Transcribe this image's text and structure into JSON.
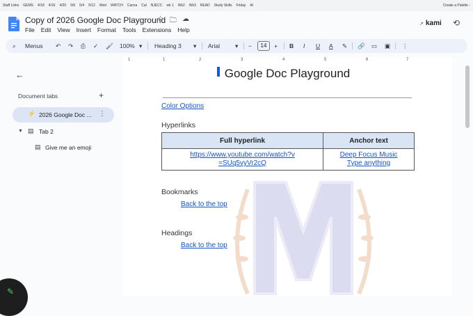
{
  "bookmarks": [
    "Staff Links",
    "GEMS",
    "4/18",
    "4/16",
    "4/20",
    "5/6",
    "5/4",
    "5/12",
    "Wed",
    "WATCH",
    "Canva",
    "Cal",
    "NJECC",
    "wk 1",
    "Wk2",
    "Wk3",
    "READ",
    "Study Skills",
    "Friday",
    "AI"
  ],
  "bookmark_last": "Create a Palette -",
  "header": {
    "title": "Copy of 2026 Google Doc Playground",
    "brand": "kami",
    "menus": [
      "File",
      "Edit",
      "View",
      "Insert",
      "Format",
      "Tools",
      "Extensions",
      "Help"
    ]
  },
  "toolbar": {
    "menus_label": "Menus",
    "zoom": "100%",
    "style": "Heading 3",
    "font": "Arial",
    "font_size": "14",
    "bold": "B",
    "italic": "I",
    "underline": "U",
    "text_color": "A",
    "minus": "−",
    "plus": "+"
  },
  "ruler": [
    "1",
    "1",
    "2",
    "3",
    "4",
    "5",
    "6",
    "7"
  ],
  "sidebar": {
    "heading": "Document tabs",
    "tabs": [
      {
        "label": "2026 Google Doc ..."
      },
      {
        "label": "Tab 2"
      }
    ],
    "subtab": "Give me an emoji"
  },
  "doc": {
    "title": "Google Doc Playground",
    "color_options": "Color Options",
    "hyperlinks_heading": "Hyperlinks",
    "table": {
      "headers": [
        "Full hyperlink",
        "Anchor text"
      ],
      "url_line1": "https://www.youtube.com/watch?v",
      "url_line2": "=SUq5vyVr2cQ",
      "anchor1": "Deep Focus Music",
      "anchor2": "Type anything"
    },
    "bookmarks_heading": "Bookmarks",
    "back_to_top": "Back to the top",
    "headings_heading": "Headings",
    "back_to_top2": "Back to the top"
  }
}
